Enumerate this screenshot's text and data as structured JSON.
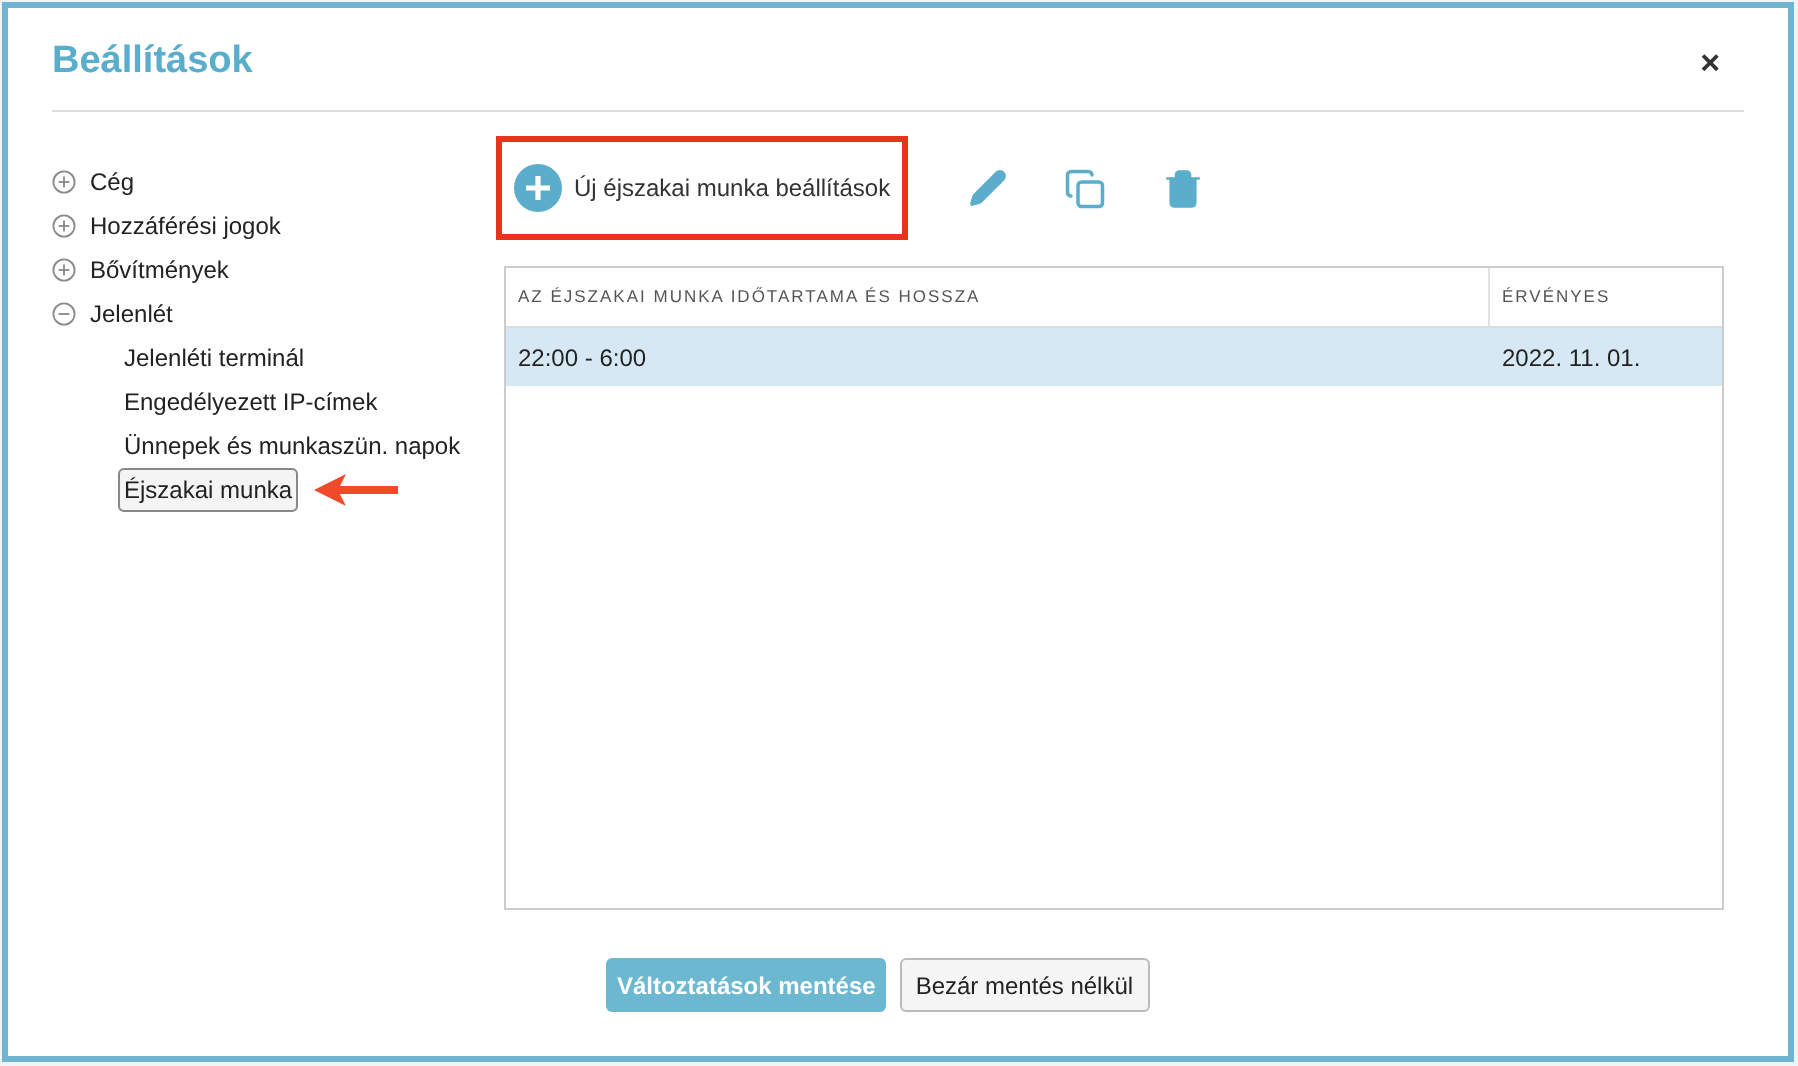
{
  "dialog": {
    "title": "Beállítások",
    "close": "×"
  },
  "sidebar": {
    "items": [
      {
        "label": "Cég",
        "expanded": false
      },
      {
        "label": "Hozzáférési jogok",
        "expanded": false
      },
      {
        "label": "Bővítmények",
        "expanded": false
      },
      {
        "label": "Jelenlét",
        "expanded": true,
        "children": [
          {
            "label": "Jelenléti terminál",
            "selected": false,
            "pointed": false
          },
          {
            "label": "Engedélyezett IP-címek",
            "selected": false,
            "pointed": false
          },
          {
            "label": "Ünnepek és munkaszün. napok",
            "selected": false,
            "pointed": false
          },
          {
            "label": "Éjszakai munka",
            "selected": true,
            "pointed": true
          }
        ]
      }
    ]
  },
  "toolbar": {
    "add_button": {
      "label": "Új éjszakai munka beállítások",
      "highlighted": true
    },
    "actions": [
      {
        "kind": "edit"
      },
      {
        "kind": "copy"
      },
      {
        "kind": "delete"
      }
    ]
  },
  "table": {
    "columns": [
      "AZ ÉJSZAKAI MUNKA IDŐTARTAMA ÉS HOSSZA",
      "ÉRVÉNYES"
    ],
    "rows": [
      {
        "cells": [
          "22:00 - 6:00",
          "2022. 11. 01."
        ],
        "selected": true
      }
    ]
  },
  "footer": {
    "buttons": [
      {
        "label": "Változtatások mentése",
        "kind": "primary"
      },
      {
        "label": "Bezár mentés nélkül",
        "kind": "secondary"
      }
    ]
  }
}
